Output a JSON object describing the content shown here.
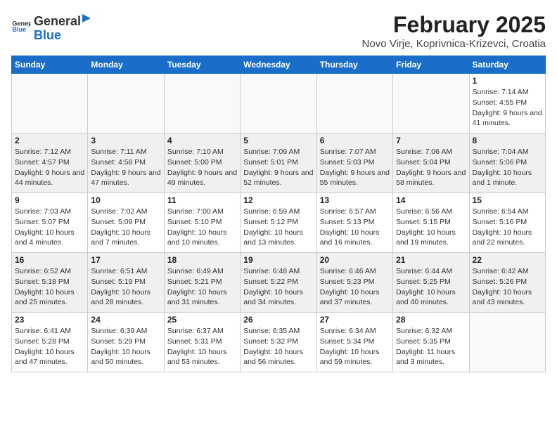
{
  "logo": {
    "general": "General",
    "blue": "Blue"
  },
  "title": "February 2025",
  "subtitle": "Novo Virje, Koprivnica-Krizevci, Croatia",
  "days_of_week": [
    "Sunday",
    "Monday",
    "Tuesday",
    "Wednesday",
    "Thursday",
    "Friday",
    "Saturday"
  ],
  "weeks": [
    [
      {
        "day": "",
        "info": ""
      },
      {
        "day": "",
        "info": ""
      },
      {
        "day": "",
        "info": ""
      },
      {
        "day": "",
        "info": ""
      },
      {
        "day": "",
        "info": ""
      },
      {
        "day": "",
        "info": ""
      },
      {
        "day": "1",
        "info": "Sunrise: 7:14 AM\nSunset: 4:55 PM\nDaylight: 9 hours and 41 minutes."
      }
    ],
    [
      {
        "day": "2",
        "info": "Sunrise: 7:12 AM\nSunset: 4:57 PM\nDaylight: 9 hours and 44 minutes."
      },
      {
        "day": "3",
        "info": "Sunrise: 7:11 AM\nSunset: 4:58 PM\nDaylight: 9 hours and 47 minutes."
      },
      {
        "day": "4",
        "info": "Sunrise: 7:10 AM\nSunset: 5:00 PM\nDaylight: 9 hours and 49 minutes."
      },
      {
        "day": "5",
        "info": "Sunrise: 7:09 AM\nSunset: 5:01 PM\nDaylight: 9 hours and 52 minutes."
      },
      {
        "day": "6",
        "info": "Sunrise: 7:07 AM\nSunset: 5:03 PM\nDaylight: 9 hours and 55 minutes."
      },
      {
        "day": "7",
        "info": "Sunrise: 7:06 AM\nSunset: 5:04 PM\nDaylight: 9 hours and 58 minutes."
      },
      {
        "day": "8",
        "info": "Sunrise: 7:04 AM\nSunset: 5:06 PM\nDaylight: 10 hours and 1 minute."
      }
    ],
    [
      {
        "day": "9",
        "info": "Sunrise: 7:03 AM\nSunset: 5:07 PM\nDaylight: 10 hours and 4 minutes."
      },
      {
        "day": "10",
        "info": "Sunrise: 7:02 AM\nSunset: 5:09 PM\nDaylight: 10 hours and 7 minutes."
      },
      {
        "day": "11",
        "info": "Sunrise: 7:00 AM\nSunset: 5:10 PM\nDaylight: 10 hours and 10 minutes."
      },
      {
        "day": "12",
        "info": "Sunrise: 6:59 AM\nSunset: 5:12 PM\nDaylight: 10 hours and 13 minutes."
      },
      {
        "day": "13",
        "info": "Sunrise: 6:57 AM\nSunset: 5:13 PM\nDaylight: 10 hours and 16 minutes."
      },
      {
        "day": "14",
        "info": "Sunrise: 6:56 AM\nSunset: 5:15 PM\nDaylight: 10 hours and 19 minutes."
      },
      {
        "day": "15",
        "info": "Sunrise: 6:54 AM\nSunset: 5:16 PM\nDaylight: 10 hours and 22 minutes."
      }
    ],
    [
      {
        "day": "16",
        "info": "Sunrise: 6:52 AM\nSunset: 5:18 PM\nDaylight: 10 hours and 25 minutes."
      },
      {
        "day": "17",
        "info": "Sunrise: 6:51 AM\nSunset: 5:19 PM\nDaylight: 10 hours and 28 minutes."
      },
      {
        "day": "18",
        "info": "Sunrise: 6:49 AM\nSunset: 5:21 PM\nDaylight: 10 hours and 31 minutes."
      },
      {
        "day": "19",
        "info": "Sunrise: 6:48 AM\nSunset: 5:22 PM\nDaylight: 10 hours and 34 minutes."
      },
      {
        "day": "20",
        "info": "Sunrise: 6:46 AM\nSunset: 5:23 PM\nDaylight: 10 hours and 37 minutes."
      },
      {
        "day": "21",
        "info": "Sunrise: 6:44 AM\nSunset: 5:25 PM\nDaylight: 10 hours and 40 minutes."
      },
      {
        "day": "22",
        "info": "Sunrise: 6:42 AM\nSunset: 5:26 PM\nDaylight: 10 hours and 43 minutes."
      }
    ],
    [
      {
        "day": "23",
        "info": "Sunrise: 6:41 AM\nSunset: 5:28 PM\nDaylight: 10 hours and 47 minutes."
      },
      {
        "day": "24",
        "info": "Sunrise: 6:39 AM\nSunset: 5:29 PM\nDaylight: 10 hours and 50 minutes."
      },
      {
        "day": "25",
        "info": "Sunrise: 6:37 AM\nSunset: 5:31 PM\nDaylight: 10 hours and 53 minutes."
      },
      {
        "day": "26",
        "info": "Sunrise: 6:35 AM\nSunset: 5:32 PM\nDaylight: 10 hours and 56 minutes."
      },
      {
        "day": "27",
        "info": "Sunrise: 6:34 AM\nSunset: 5:34 PM\nDaylight: 10 hours and 59 minutes."
      },
      {
        "day": "28",
        "info": "Sunrise: 6:32 AM\nSunset: 5:35 PM\nDaylight: 11 hours and 3 minutes."
      },
      {
        "day": "",
        "info": ""
      }
    ]
  ]
}
